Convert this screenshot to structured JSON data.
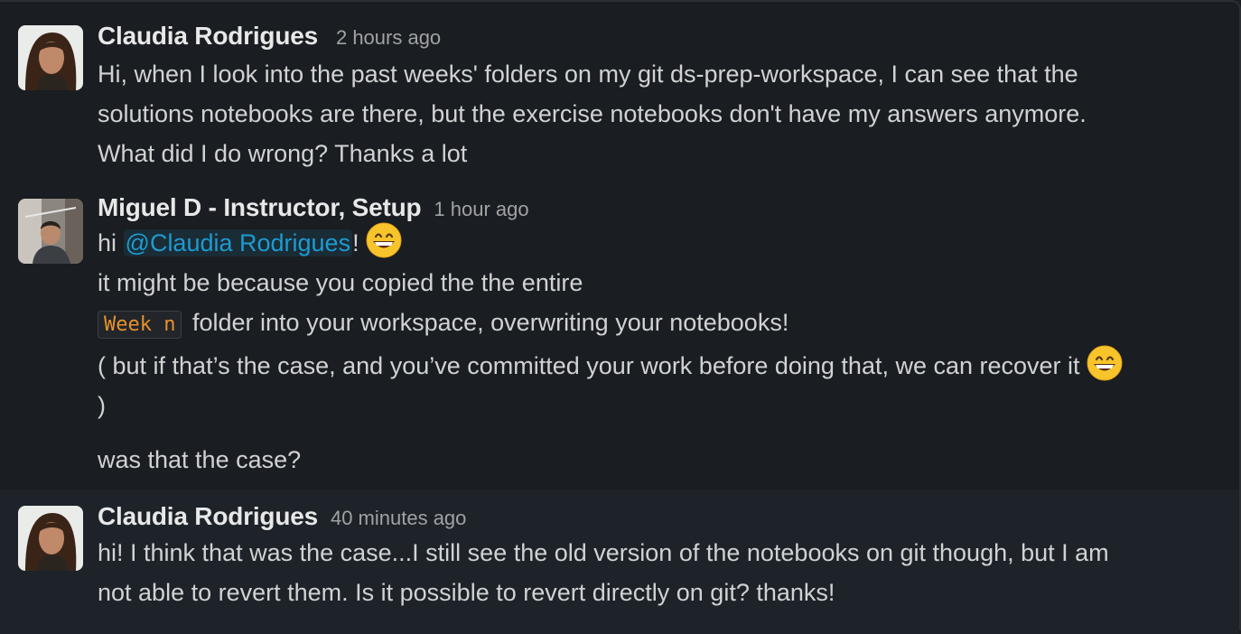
{
  "messages": [
    {
      "author": "Claudia Rodrigues",
      "time": "2 hours ago",
      "lines": [
        "Hi, when I look into the past weeks' folders on my git ds-prep-workspace, I can see that the",
        "solutions notebooks are there, but the exercise notebooks don't have my answers anymore.",
        "What did I do wrong? Thanks a lot"
      ]
    },
    {
      "author": "Miguel D - Instructor, Setup",
      "time": "1 hour ago",
      "line1_prefix": "hi ",
      "mention": "@Claudia Rodrigues",
      "line1_suffix": "!",
      "line2": "it might be because you copied the the entire",
      "code": "Week n",
      "line3_rest": "folder into your workspace, overwriting your notebooks!",
      "line4": "( but if that’s the case, and you’ve committed your work before doing that, we can recover it",
      "line5": ")",
      "line6": "was that the case?",
      "emoji": "grinning-face-emoji"
    },
    {
      "author": "Claudia Rodrigues",
      "time": "40 minutes ago",
      "lines": [
        "hi! I think that was the case...I still see the old version of the notebooks on git though, but I am",
        "not able to revert them. Is it possible to revert directly on git? thanks!"
      ]
    }
  ],
  "colors": {
    "background": "#1a1d21",
    "highlight": "#1d2329",
    "mention": "#1d9bd1",
    "code": "#e8912d"
  }
}
